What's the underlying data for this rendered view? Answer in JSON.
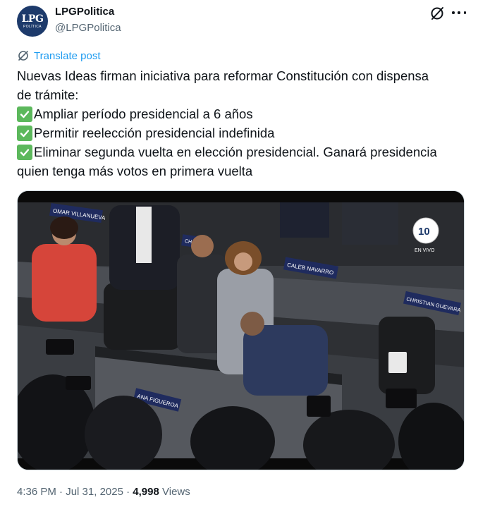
{
  "author": {
    "avatar_text": "LPG",
    "avatar_subtext": "POLÍTICA",
    "display_name": "LPGPolitica",
    "handle": "@LPGPolitica"
  },
  "icons": {
    "grok": "grok-icon",
    "more": "more-icon",
    "translate": "translate-icon",
    "check": "check-mark-icon"
  },
  "translate": {
    "label": "Translate post"
  },
  "post": {
    "line1": "Nuevas Ideas firman iniciativa para reformar Constitución con dispensa",
    "line2": "de trámite:",
    "items": [
      "Ampliar período presidencial a 6 años",
      "Permitir reelección presidencial indefinida",
      "Eliminar segunda vuelta en elección presidencial. Ganará presidencia"
    ],
    "line6": "quien tenga más votos en primera vuelta"
  },
  "media": {
    "nameplates": [
      "OMAR VILLANUEVA",
      "CHAM...",
      "CALEB NAVARRO",
      "CHRISTIAN GUEVARA",
      "ANA FIGUEROA"
    ],
    "channel_logo": "10",
    "live_label": "EN VIVO"
  },
  "meta": {
    "time": "4:36 PM",
    "separator": "·",
    "date": "Jul 31, 2025",
    "views_count": "4,998",
    "views_label": "Views"
  },
  "colors": {
    "link": "#1d9bf0",
    "secondary_text": "#536471",
    "check_green": "#5cb85c",
    "avatar_bg": "#1d3a6b"
  }
}
